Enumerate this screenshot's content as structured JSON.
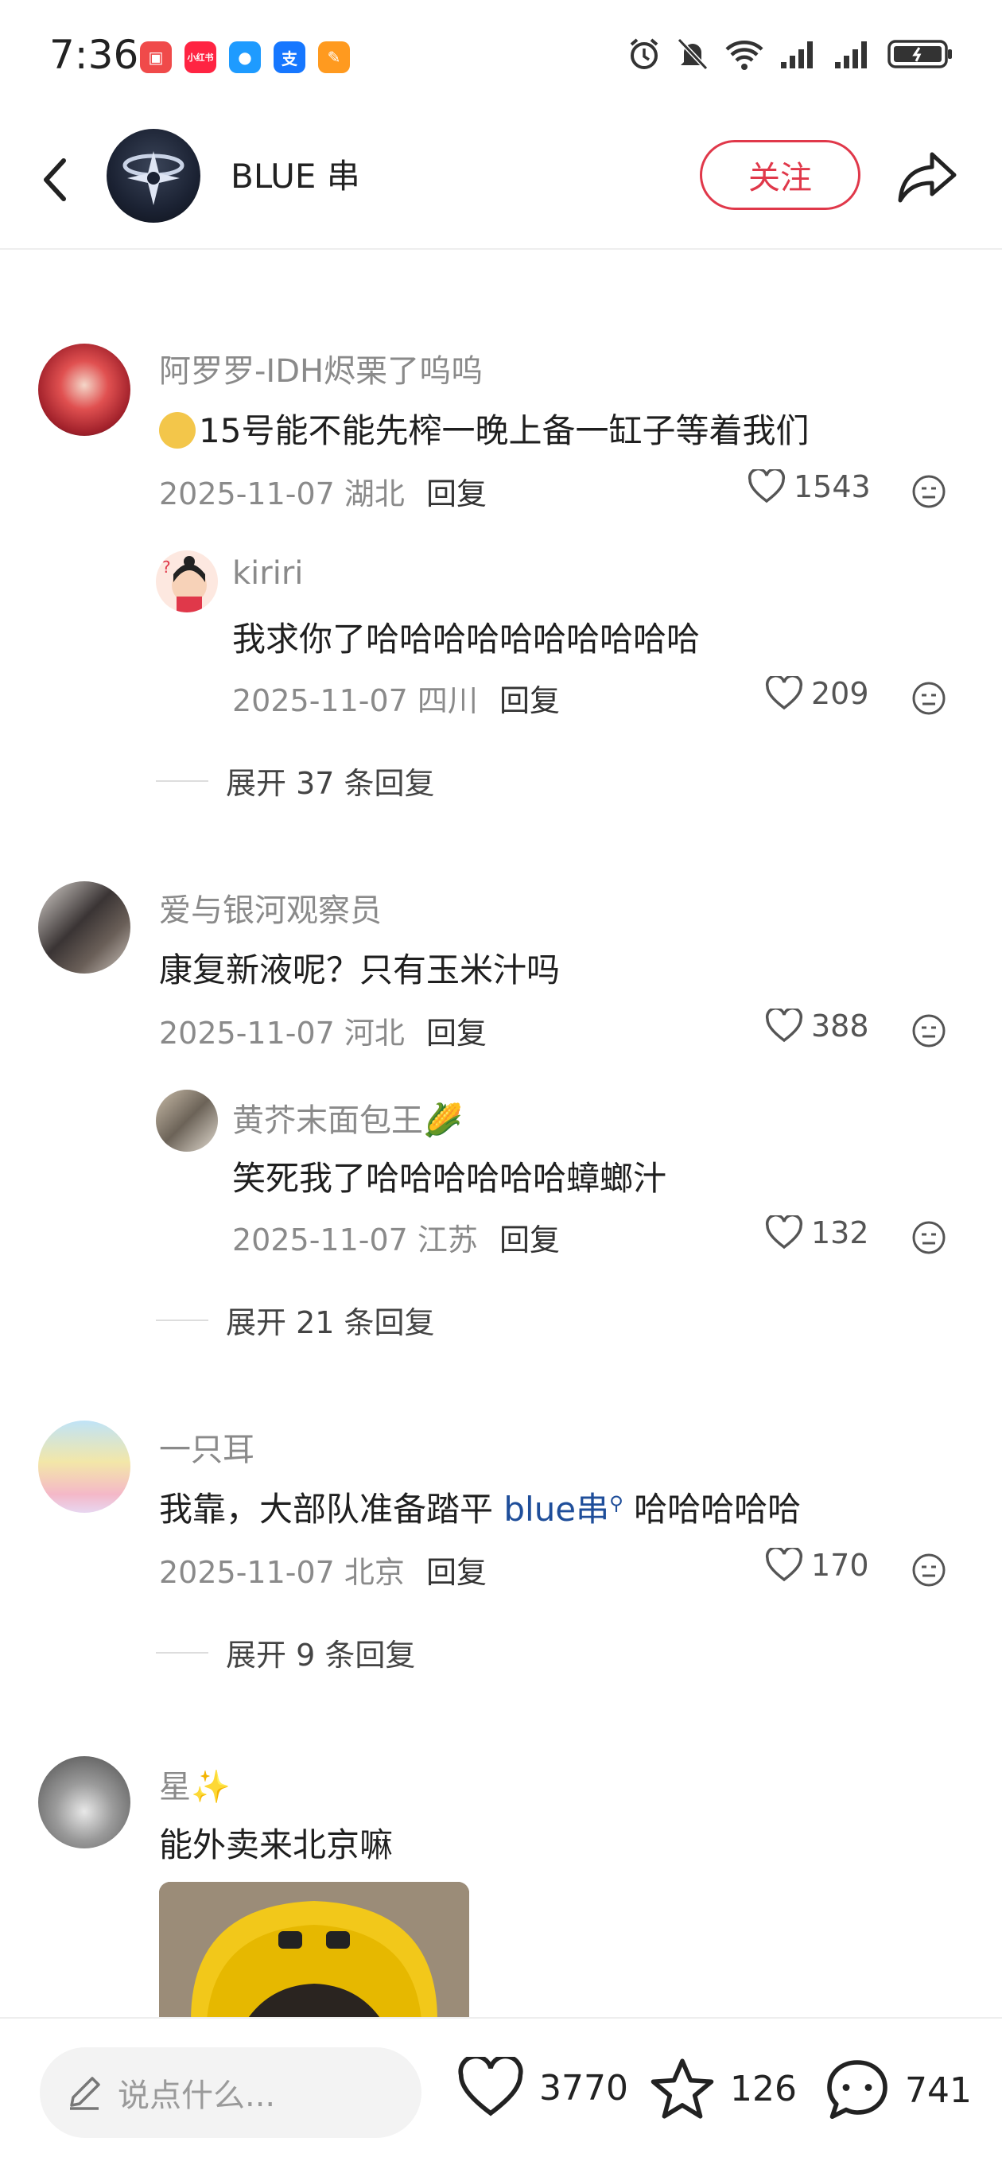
{
  "status_bar": {
    "time": "7:36",
    "apps": [
      {
        "name": "red-app-icon",
        "color": "#f04a4a",
        "glyph": "▣"
      },
      {
        "name": "xiaohongshu-icon",
        "color": "#ff2442",
        "glyph": "小红书"
      },
      {
        "name": "message-app-icon",
        "color": "#1e9bff",
        "glyph": "💬"
      },
      {
        "name": "alipay-icon",
        "color": "#1677ff",
        "glyph": "支"
      },
      {
        "name": "orange-app-icon",
        "color": "#ff9a1f",
        "glyph": "✎"
      }
    ]
  },
  "header": {
    "author": "BLUE 串",
    "follow_label": "关注"
  },
  "comments": [
    {
      "user": "阿罗罗-IDH烬栗了呜呜",
      "text": "15号能不能先榨一晚上备一缸子等着我们",
      "date": "2025-11-07 湖北",
      "reply": "回复",
      "likes": "1543",
      "sub": {
        "user": "kiriri",
        "text": "我求你了哈哈哈哈哈哈哈哈哈哈",
        "date": "2025-11-07 四川",
        "reply": "回复",
        "likes": "209"
      },
      "expand": "展开 37 条回复"
    },
    {
      "user": "爱与银河观察员",
      "text": "康复新液呢？只有玉米汁吗",
      "date": "2025-11-07 河北",
      "reply": "回复",
      "likes": "388",
      "sub": {
        "user": "黄芥末面包王🌽",
        "text": "笑死我了哈哈哈哈哈哈蟑螂汁",
        "date": "2025-11-07 江苏",
        "reply": "回复",
        "likes": "132"
      },
      "expand": "展开 21 条回复"
    },
    {
      "user": "一只耳",
      "text_prefix": "我靠，大部队准备踏平 ",
      "mention": "blue串",
      "text_suffix": " 哈哈哈哈哈",
      "date": "2025-11-07 北京",
      "reply": "回复",
      "likes": "170",
      "expand": "展开 9 条回复"
    },
    {
      "user": "星✨",
      "text": "能外卖来北京嘛"
    }
  ],
  "bottom_bar": {
    "input_placeholder": "说点什么...",
    "likes": "3770",
    "stars": "126",
    "comments": "741"
  }
}
